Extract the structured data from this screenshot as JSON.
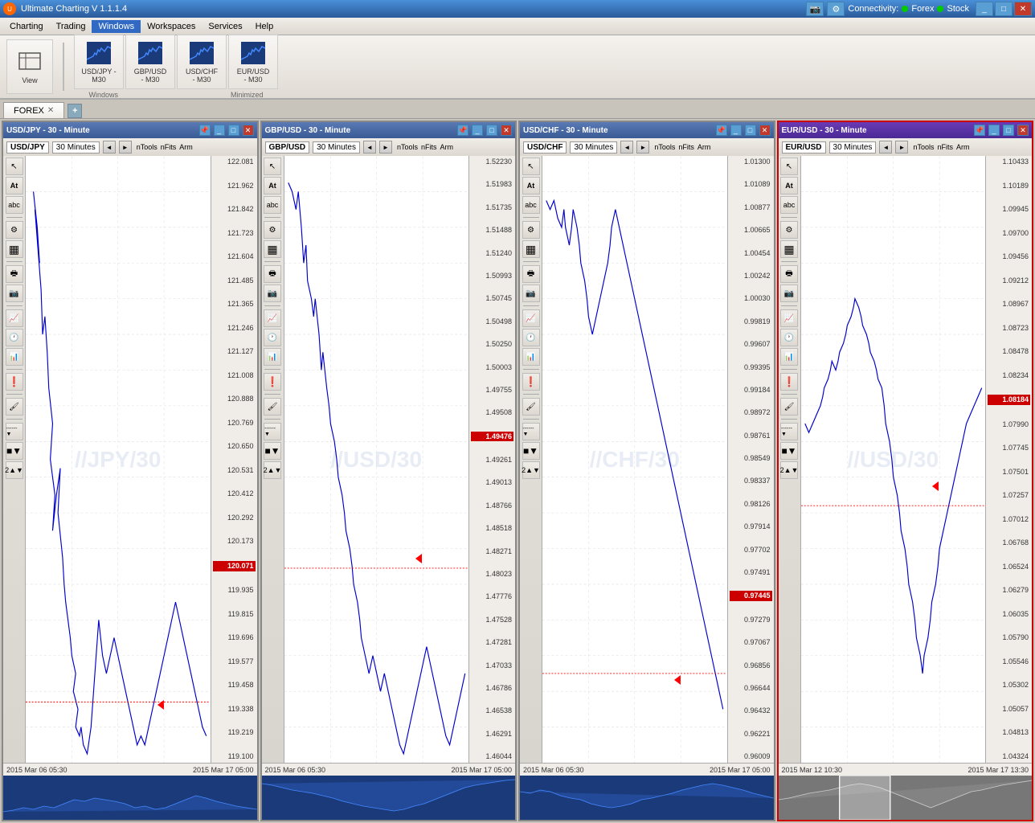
{
  "app": {
    "title": "Ultimate Charting V 1.1.1.4",
    "connectivity_label": "Connectivity:",
    "forex_label": "Forex",
    "stock_label": "Stock"
  },
  "menu": {
    "items": [
      "Charting",
      "Trading",
      "Windows",
      "Workspaces",
      "Services",
      "Help"
    ]
  },
  "toolbar": {
    "view_label": "View",
    "windows_section": "Windows",
    "minimized_section": "Minimized",
    "items": [
      {
        "label": "USD/JPY\n- M30",
        "icon": "chart"
      },
      {
        "label": "GBP/USD\n- M30",
        "icon": "chart"
      },
      {
        "label": "USD/CHF\n- M30",
        "icon": "chart"
      },
      {
        "label": "EUR/USD\n- M30",
        "icon": "chart"
      }
    ]
  },
  "tabs": [
    {
      "label": "FOREX",
      "active": true
    }
  ],
  "charts": [
    {
      "id": "usdjpy",
      "title": "USD/JPY - 30 - Minute",
      "symbol": "USD/JPY",
      "timeframe": "30 Minutes",
      "watermark": "//JPY/30",
      "current_price": "120.071",
      "current_price_highlighted": true,
      "prices": [
        "122.081",
        "121.962",
        "121.842",
        "121.723",
        "121.604",
        "121.485",
        "121.365",
        "121.246",
        "121.127",
        "121.008",
        "120.888",
        "120.769",
        "120.650",
        "120.531",
        "120.412",
        "120.292",
        "120.173",
        "120.071",
        "119.935",
        "119.815",
        "119.696",
        "119.577",
        "119.458",
        "119.338",
        "119.219",
        "119.100"
      ],
      "dates": [
        "2015 Mar 06 05:30",
        "2015 Mar 17 05:00"
      ]
    },
    {
      "id": "gbpusd",
      "title": "GBP/USD - 30 - Minute",
      "symbol": "GBP/USD",
      "timeframe": "30 Minutes",
      "watermark": "//USD/30",
      "current_price": "1.49476",
      "current_price_highlighted": true,
      "prices": [
        "1.52230",
        "1.51983",
        "1.51735",
        "1.51488",
        "1.51240",
        "1.50993",
        "1.50745",
        "1.50498",
        "1.50250",
        "1.50003",
        "1.49755",
        "1.49508",
        "1.49476",
        "1.49261",
        "1.49013",
        "1.48766",
        "1.48518",
        "1.48271",
        "1.48023",
        "1.47776",
        "1.47528",
        "1.47281",
        "1.47033",
        "1.46786",
        "1.46538",
        "1.46291",
        "1.46044"
      ],
      "dates": [
        "2015 Mar 06 05:30",
        "2015 Mar 17 05:00"
      ]
    },
    {
      "id": "usdchf",
      "title": "USD/CHF - 30 - Minute",
      "symbol": "USD/CHF",
      "timeframe": "30 Minutes",
      "watermark": "//CHF/30",
      "current_price": "0.97445",
      "current_price_highlighted": true,
      "prices": [
        "1.01300",
        "1.01089",
        "1.00877",
        "1.00665",
        "1.00454",
        "1.00242",
        "1.00030",
        "0.99819",
        "0.99607",
        "0.99395",
        "0.99184",
        "0.98972",
        "0.98761",
        "0.98549",
        "0.98337",
        "0.98126",
        "0.97914",
        "0.97702",
        "0.97491",
        "0.97445",
        "0.97279",
        "0.97067",
        "0.96856",
        "0.96644",
        "0.96432",
        "0.96221",
        "0.96009"
      ],
      "dates": [
        "2015 Mar 06 05:30",
        "2015 Mar 17 05:00"
      ]
    },
    {
      "id": "eurusd",
      "title": "EUR/USD - 30 - Minute",
      "symbol": "EUR/USD",
      "timeframe": "30 Minutes",
      "watermark": "//USD/30",
      "current_price": "1.08184",
      "current_price_highlighted": true,
      "prices": [
        "1.10433",
        "1.10189",
        "1.09945",
        "1.09700",
        "1.09456",
        "1.09212",
        "1.08967",
        "1.08723",
        "1.08478",
        "1.08234",
        "1.08184",
        "1.07990",
        "1.07745",
        "1.07501",
        "1.07257",
        "1.07012",
        "1.06768",
        "1.06524",
        "1.06279",
        "1.06035",
        "1.05790",
        "1.05546",
        "1.05302",
        "1.05057",
        "1.04813",
        "1.04324"
      ],
      "dates": [
        "2015 Mar 12 10:30",
        "2015 Mar 17 13:30"
      ]
    }
  ],
  "tools": {
    "cursor": "↖",
    "text_at": "At",
    "text": "abc",
    "settings": "⚙",
    "grid": "▦",
    "print": "🖶",
    "camera": "📷",
    "line": "📈",
    "clock": "🕐",
    "excel": "📊",
    "alert": "❗",
    "brush": "🖌",
    "dotted": "- - -",
    "square": "■",
    "number": "2"
  }
}
